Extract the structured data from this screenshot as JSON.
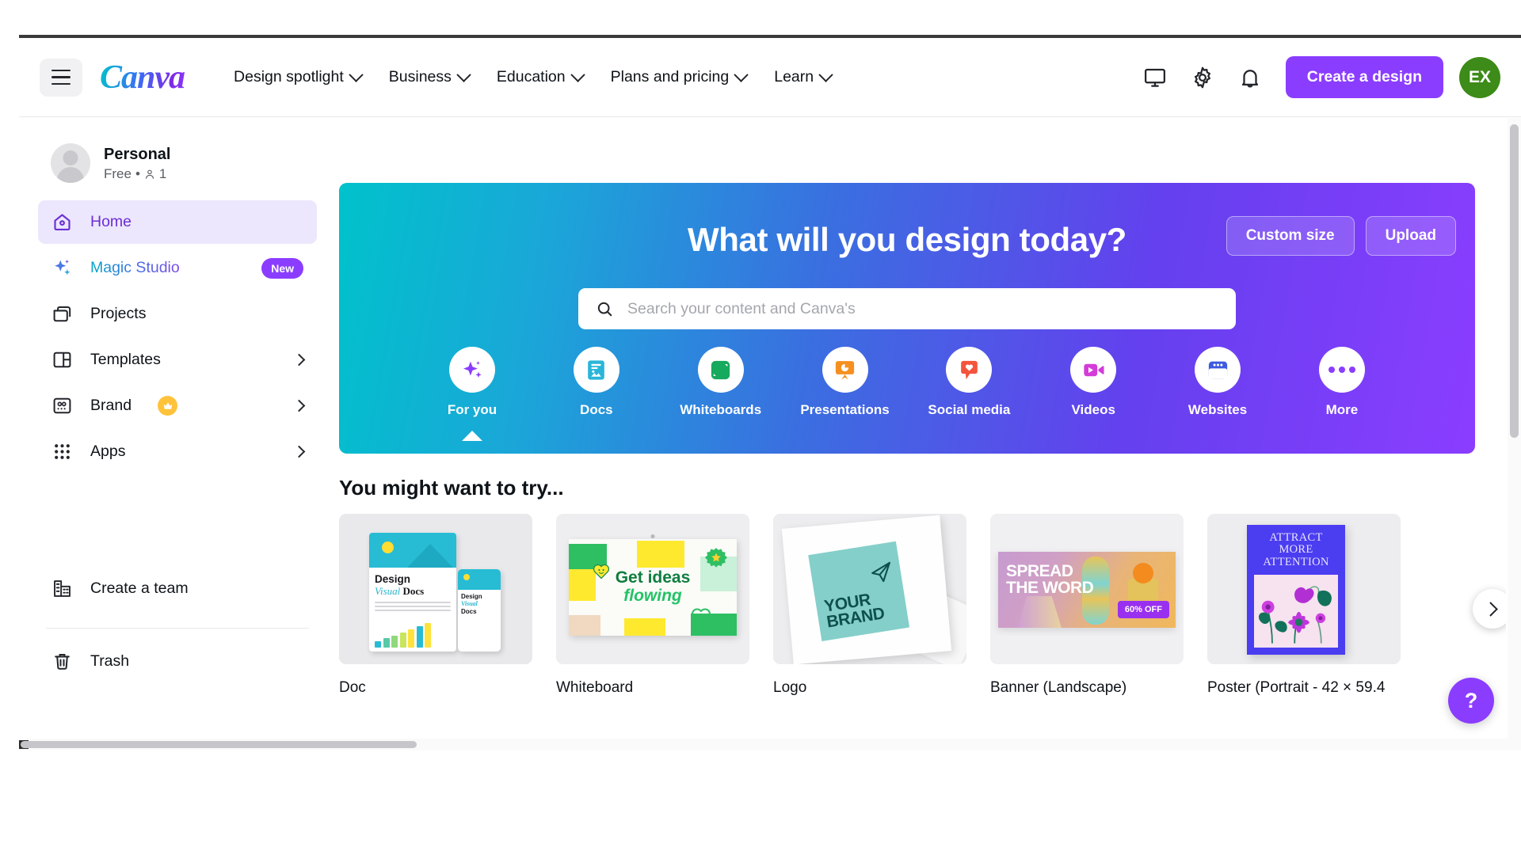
{
  "header": {
    "logo_text": "Canva",
    "menu_icon": "hamburger-icon",
    "nav": [
      {
        "label": "Design spotlight"
      },
      {
        "label": "Business"
      },
      {
        "label": "Education"
      },
      {
        "label": "Plans and pricing"
      },
      {
        "label": "Learn"
      }
    ],
    "icons": [
      {
        "name": "monitor-icon"
      },
      {
        "name": "gear-icon"
      },
      {
        "name": "bell-icon"
      }
    ],
    "cta_label": "Create a design",
    "avatar_initials": "EX",
    "avatar_color": "#3d8b18",
    "cta_color": "#8b3dff"
  },
  "sidebar": {
    "account": {
      "name": "Personal",
      "plan": "Free",
      "separator": "•",
      "members": "1"
    },
    "items": [
      {
        "label": "Home",
        "icon": "home-icon",
        "active": true
      },
      {
        "label": "Magic Studio",
        "icon": "sparkle-icon",
        "badge": "New"
      },
      {
        "label": "Projects",
        "icon": "folder-icon"
      },
      {
        "label": "Templates",
        "icon": "templates-icon",
        "arrow": true
      },
      {
        "label": "Brand",
        "icon": "brand-icon",
        "crown": true,
        "arrow": true
      },
      {
        "label": "Apps",
        "icon": "apps-grid-icon",
        "arrow": true
      }
    ],
    "bottom": [
      {
        "label": "Create a team",
        "icon": "building-icon"
      },
      {
        "label": "Trash",
        "icon": "trash-icon"
      }
    ]
  },
  "banner": {
    "heading": "What will you design today?",
    "custom_size_label": "Custom size",
    "upload_label": "Upload",
    "search": {
      "placeholder": "Search your content and Canva's",
      "value": "",
      "icon": "search-icon"
    },
    "categories": [
      {
        "label": "For you",
        "icon": "sparkle-icon",
        "color": "#8b3dff",
        "active": true
      },
      {
        "label": "Docs",
        "icon": "doc-icon",
        "color": "#2ab6d9"
      },
      {
        "label": "Whiteboards",
        "icon": "whiteboard-icon",
        "color": "#17a95d"
      },
      {
        "label": "Presentations",
        "icon": "presentation-icon",
        "color": "#f5901f"
      },
      {
        "label": "Social media",
        "icon": "heart-chat-icon",
        "color": "#f4543d"
      },
      {
        "label": "Videos",
        "icon": "video-icon",
        "color": "#d43bd9"
      },
      {
        "label": "Websites",
        "icon": "browser-icon",
        "color": "#3d5ae0"
      },
      {
        "label": "More",
        "icon": "more-dots-icon",
        "color": "#8b3dff"
      }
    ]
  },
  "suggestions": {
    "title": "You might want to try...",
    "cards": [
      {
        "label": "Doc",
        "art": "doc",
        "art_text_1": "Design",
        "art_text_2a": "Visual",
        "art_text_2b": "Docs"
      },
      {
        "label": "Whiteboard",
        "art": "whiteboard",
        "art_text_1": "Get ideas",
        "art_text_2": "flowing"
      },
      {
        "label": "Logo",
        "art": "logo",
        "art_text_1": "YOUR",
        "art_text_2": "BRAND"
      },
      {
        "label": "Banner (Landscape)",
        "art": "banner",
        "art_text_1": "SPREAD",
        "art_text_2": "THE WORD",
        "art_badge": "60% OFF"
      },
      {
        "label": "Poster (Portrait - 42 × 59.4",
        "art": "poster",
        "art_text_1": "ATTRACT",
        "art_text_2": "MORE",
        "art_text_3": "ATTENTION"
      }
    ],
    "next_label": "next-arrow"
  },
  "help": {
    "label": "?"
  }
}
